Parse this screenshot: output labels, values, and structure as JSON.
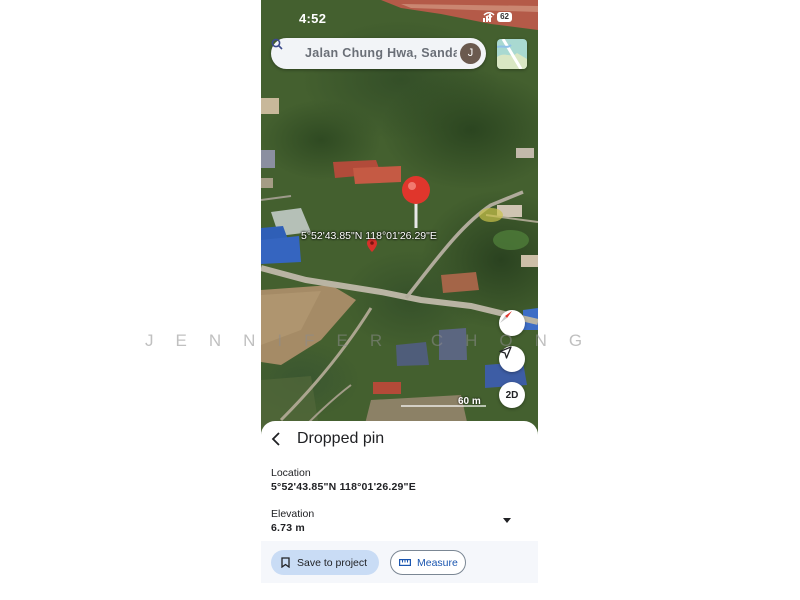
{
  "status_bar": {
    "time": "4:52",
    "battery": "62"
  },
  "search": {
    "query": "Jalan Chung Hwa, Sanda",
    "avatar_initial": "J"
  },
  "map": {
    "pin_coordinates": "5°52'43.85\"N 118°01'26.29\"E",
    "scale_label": "60 m",
    "view_mode_button": "2D"
  },
  "sheet": {
    "title": "Dropped pin",
    "location": {
      "label": "Location",
      "value": "5°52'43.85\"N 118°01'26.29\"E"
    },
    "elevation": {
      "label": "Elevation",
      "value": "6.73 m"
    }
  },
  "actions": {
    "save_label": "Save to project",
    "measure_label": "Measure"
  },
  "watermark": "JENNIFER CHONG",
  "icons": [
    "search-icon",
    "layers-icon",
    "compass-icon",
    "my-location-icon",
    "back-icon",
    "dropdown-icon",
    "bookmark-icon",
    "ruler-icon",
    "pin-icon",
    "wifi-icon",
    "signal-icon"
  ],
  "colors": {
    "pin_red": "#e0362c",
    "accent_blue": "#1a56b0",
    "save_button_bg": "#c9dcf5"
  }
}
